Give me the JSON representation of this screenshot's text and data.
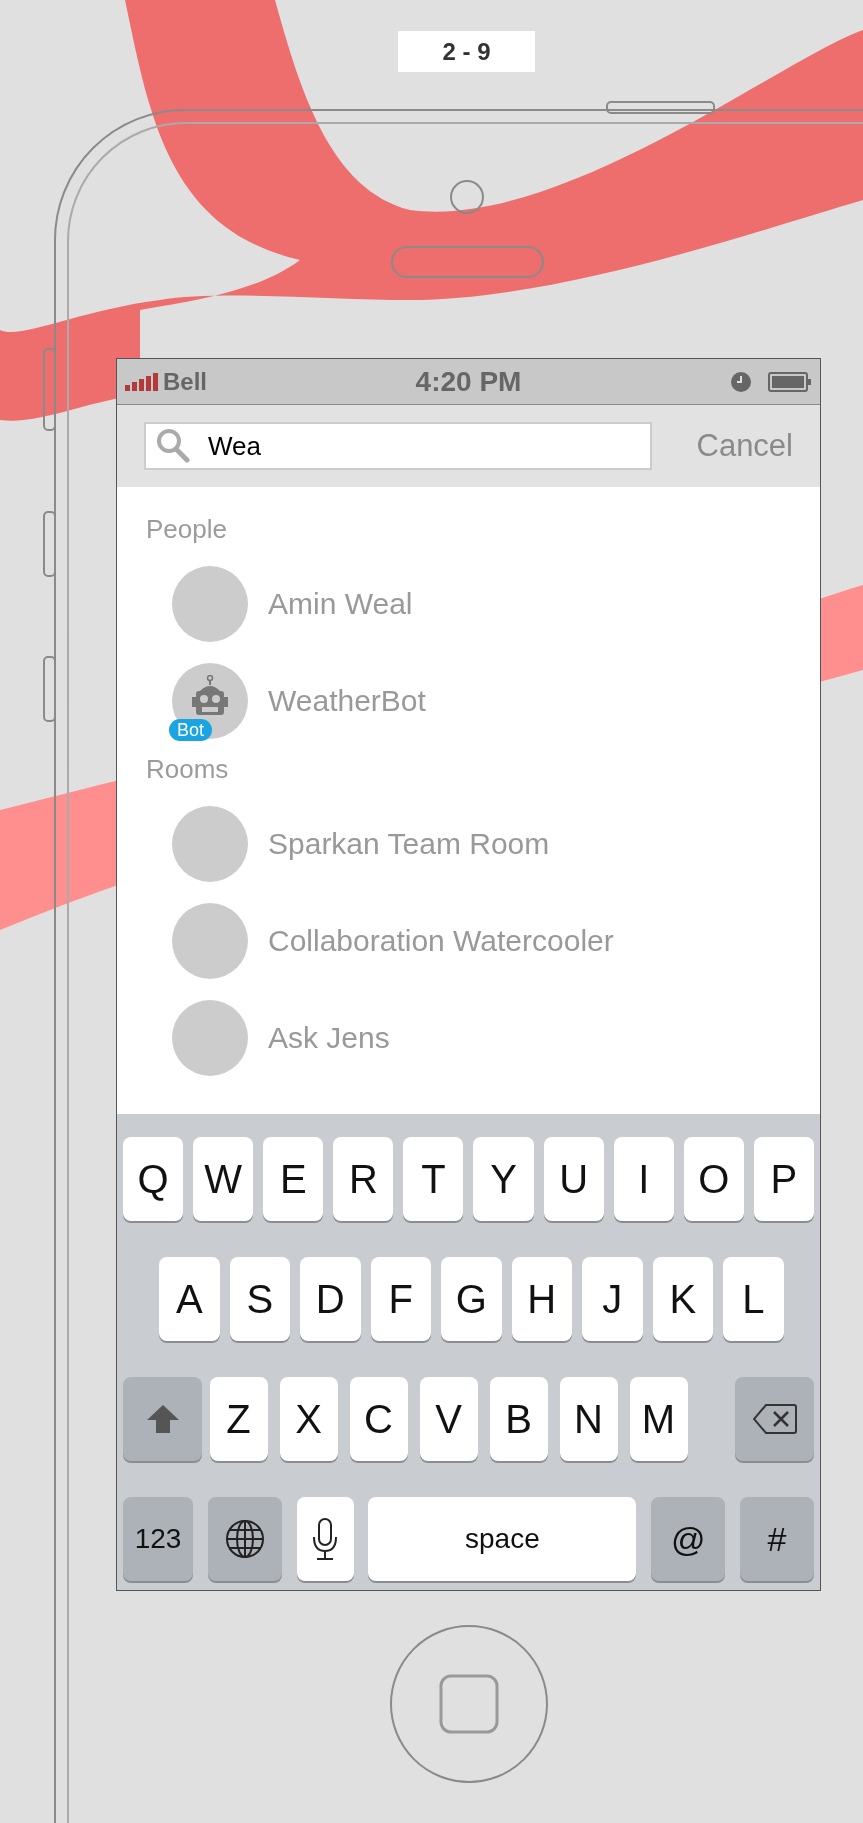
{
  "page_label": "2 - 9",
  "status_bar": {
    "carrier": "Bell",
    "time": "4:20 PM"
  },
  "search": {
    "value": "Wea",
    "cancel": "Cancel"
  },
  "sections": [
    {
      "title": "People",
      "items": [
        {
          "name": "Amin Weal",
          "kind": "person"
        },
        {
          "name": "WeatherBot",
          "kind": "bot",
          "badge": "Bot"
        }
      ]
    },
    {
      "title": "Rooms",
      "items": [
        {
          "name": "Sparkan Team Room",
          "kind": "room"
        },
        {
          "name": "Collaboration Watercooler",
          "kind": "room"
        },
        {
          "name": "Ask Jens",
          "kind": "room"
        }
      ]
    }
  ],
  "keyboard": {
    "rows": [
      {
        "keys": [
          {
            "kind": "letter",
            "label": "Q"
          },
          {
            "kind": "letter",
            "label": "W"
          },
          {
            "kind": "letter",
            "label": "E"
          },
          {
            "kind": "letter",
            "label": "R"
          },
          {
            "kind": "letter",
            "label": "T"
          },
          {
            "kind": "letter",
            "label": "Y"
          },
          {
            "kind": "letter",
            "label": "U"
          },
          {
            "kind": "letter",
            "label": "I"
          },
          {
            "kind": "letter",
            "label": "O"
          },
          {
            "kind": "letter",
            "label": "P"
          }
        ]
      },
      {
        "keys": [
          {
            "kind": "letter",
            "label": "A"
          },
          {
            "kind": "letter",
            "label": "S"
          },
          {
            "kind": "letter",
            "label": "D"
          },
          {
            "kind": "letter",
            "label": "F"
          },
          {
            "kind": "letter",
            "label": "G"
          },
          {
            "kind": "letter",
            "label": "H"
          },
          {
            "kind": "letter",
            "label": "J"
          },
          {
            "kind": "letter",
            "label": "K"
          },
          {
            "kind": "letter",
            "label": "L"
          }
        ]
      },
      {
        "keys": [
          {
            "kind": "shift"
          },
          {
            "kind": "letter",
            "label": "Z"
          },
          {
            "kind": "letter",
            "label": "X"
          },
          {
            "kind": "letter",
            "label": "C"
          },
          {
            "kind": "letter",
            "label": "V"
          },
          {
            "kind": "letter",
            "label": "B"
          },
          {
            "kind": "letter",
            "label": "N"
          },
          {
            "kind": "letter",
            "label": "M"
          },
          {
            "kind": "backspace"
          }
        ]
      },
      {
        "keys": [
          {
            "kind": "mode",
            "label": "123"
          },
          {
            "kind": "globe"
          },
          {
            "kind": "mic"
          },
          {
            "kind": "space",
            "label": "space"
          },
          {
            "kind": "symbol",
            "label": "@"
          },
          {
            "kind": "symbol",
            "label": "#"
          }
        ]
      }
    ]
  }
}
